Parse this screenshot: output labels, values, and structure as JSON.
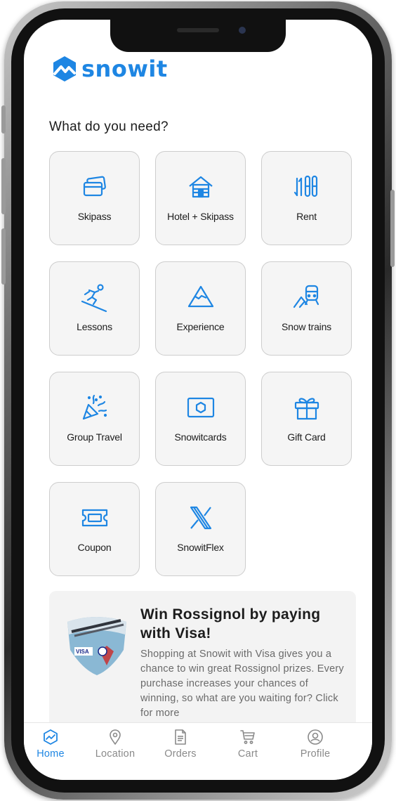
{
  "brand": {
    "name": "snowit",
    "color": "#1e86e3"
  },
  "section_title": "What do you need?",
  "services": [
    {
      "label": "Skipass",
      "icon": "skipass-cards-icon"
    },
    {
      "label": "Hotel + Skipass",
      "icon": "hotel-house-icon"
    },
    {
      "label": "Rent",
      "icon": "skis-poles-icon"
    },
    {
      "label": "Lessons",
      "icon": "skier-icon"
    },
    {
      "label": "Experience",
      "icon": "mountain-icon"
    },
    {
      "label": "Snow trains",
      "icon": "train-mountain-icon"
    },
    {
      "label": "Group Travel",
      "icon": "party-popper-icon"
    },
    {
      "label": "Snowitcards",
      "icon": "card-hexagon-icon"
    },
    {
      "label": "Gift Card",
      "icon": "gift-icon"
    },
    {
      "label": "Coupon",
      "icon": "ticket-icon"
    },
    {
      "label": "SnowitFlex",
      "icon": "flex-x-icon"
    }
  ],
  "promo": {
    "title": "Win Rossignol by paying with Visa!",
    "text": "Shopping at Snowit with Visa gives you a chance to win great Rossignol prizes. Every purchase increases your chances of winning, so what are you waiting for? Click for more",
    "image_text": "VISA"
  },
  "tabs": [
    {
      "label": "Home",
      "icon": "home-icon",
      "active": true
    },
    {
      "label": "Location",
      "icon": "location-pin-icon",
      "active": false
    },
    {
      "label": "Orders",
      "icon": "orders-document-icon",
      "active": false
    },
    {
      "label": "Cart",
      "icon": "cart-icon",
      "active": false
    },
    {
      "label": "Profile",
      "icon": "profile-icon",
      "active": false
    }
  ]
}
